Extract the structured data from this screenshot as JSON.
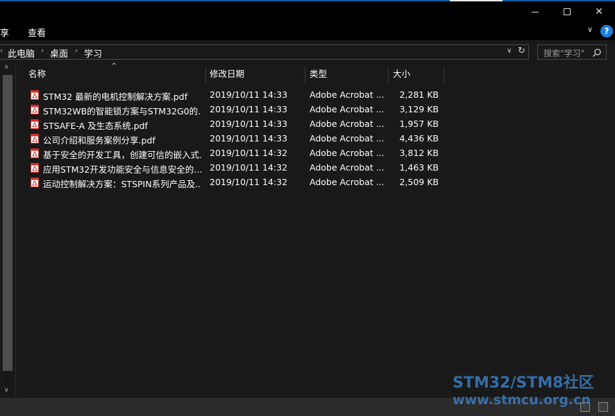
{
  "ribbon": {
    "share_tab": "享",
    "view_tab": "查看",
    "expand_icon": "chevron-down-icon",
    "help_label": "?"
  },
  "address": {
    "crumbs": [
      "此电脑",
      "桌面",
      "学习"
    ],
    "refresh_glyph": "↻",
    "dropdown_glyph": "∨"
  },
  "search": {
    "placeholder": "搜索\"学习\""
  },
  "columns": {
    "name": "名称",
    "date": "修改日期",
    "type": "类型",
    "size": "大小"
  },
  "files": [
    {
      "name": "STM32 最新的电机控制解决方案.pdf",
      "date": "2019/10/11 14:33",
      "type": "Adobe Acrobat ...",
      "size": "2,281 KB"
    },
    {
      "name": "STM32WB的智能锁方案与STM32G0的...",
      "date": "2019/10/11 14:33",
      "type": "Adobe Acrobat ...",
      "size": "3,129 KB"
    },
    {
      "name": "STSAFE-A 及生态系统.pdf",
      "date": "2019/10/11 14:33",
      "type": "Adobe Acrobat ...",
      "size": "1,957 KB"
    },
    {
      "name": "公司介绍和服务案例分享.pdf",
      "date": "2019/10/11 14:33",
      "type": "Adobe Acrobat ...",
      "size": "4,436 KB"
    },
    {
      "name": "基于安全的开发工具，创建可信的嵌入式...",
      "date": "2019/10/11 14:32",
      "type": "Adobe Acrobat ...",
      "size": "3,812 KB"
    },
    {
      "name": "应用STM32开发功能安全与信息安全的...",
      "date": "2019/10/11 14:32",
      "type": "Adobe Acrobat ...",
      "size": "1,463 KB"
    },
    {
      "name": "运动控制解决方案：STSPIN系列产品及...",
      "date": "2019/10/11 14:32",
      "type": "Adobe Acrobat ...",
      "size": "2,509 KB"
    }
  ],
  "watermark": {
    "line1": "STM32/STM8社区",
    "line2": "www.stmcu.org.cn"
  },
  "colors": {
    "background": "#191919",
    "pdf_icon_red": "#d42a2a",
    "help_blue": "#1f7fd8",
    "watermark_blue": "#3b7cc0"
  }
}
